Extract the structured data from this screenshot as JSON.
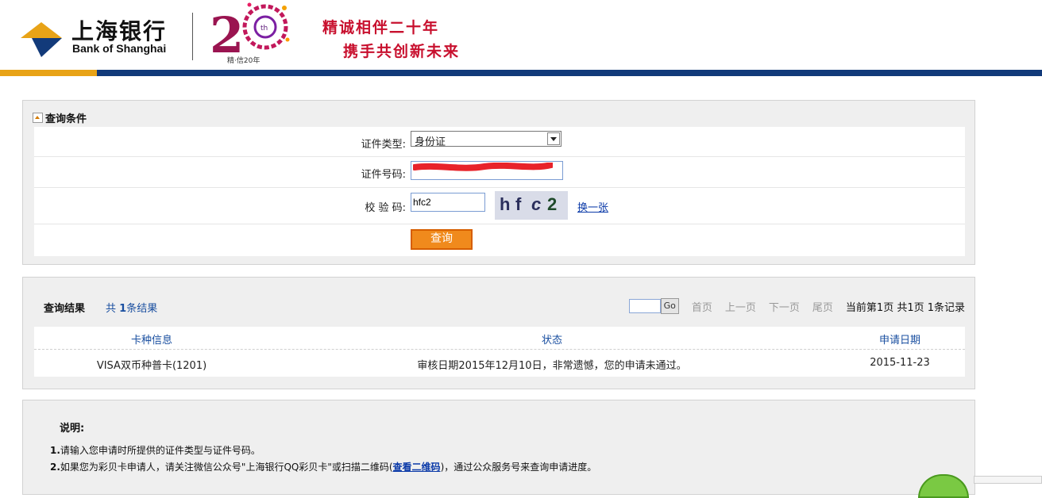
{
  "header": {
    "bank_name_cn": "上海银行",
    "bank_name_en": "Bank of Shanghai",
    "anniversary_caption": "精·信20年",
    "slogan_line1": "精诚相伴二十年",
    "slogan_line2": "携手共创新未来",
    "colors": {
      "navy": "#123a7a",
      "gold": "#e8a317",
      "red": "#c8102e"
    }
  },
  "query": {
    "title": "查询条件",
    "id_type_label": "证件类型:",
    "id_type_value": "身份证",
    "id_number_label": "证件号码:",
    "captcha_label": "校 验 码:",
    "captcha_input_value": "hfc2",
    "captcha_image_text": [
      "h",
      "f",
      "c",
      "2"
    ],
    "refresh_captcha_label": "换一张",
    "submit_label": "查询"
  },
  "result": {
    "title": "查询结果",
    "count_prefix": "共",
    "count": "1",
    "count_suffix": "条结果",
    "pager": {
      "go_label": "Go",
      "first": "首页",
      "prev": "上一页",
      "next": "下一页",
      "last": "尾页",
      "info": "当前第1页 共1页 1条记录"
    },
    "columns": [
      "卡种信息",
      "状态",
      "申请日期"
    ],
    "rows": [
      {
        "card": "VISA双币种普卡(1201)",
        "status": "审核日期2015年12月10日，非常遗憾，您的申请未通过。",
        "date": "2015-11-23"
      }
    ]
  },
  "notes": {
    "title": "说明:",
    "note1_num": "1.",
    "note1_text": "请输入您申请时所提供的证件类型与证件号码。",
    "note2_num": "2.",
    "note2_text_a": "如果您为彩贝卡申请人，请关注微信公众号\"上海银行QQ彩贝卡\"或扫描二维码(",
    "note2_link": "查看二维码",
    "note2_text_b": ")，通过公众服务号来查询申请进度。"
  }
}
